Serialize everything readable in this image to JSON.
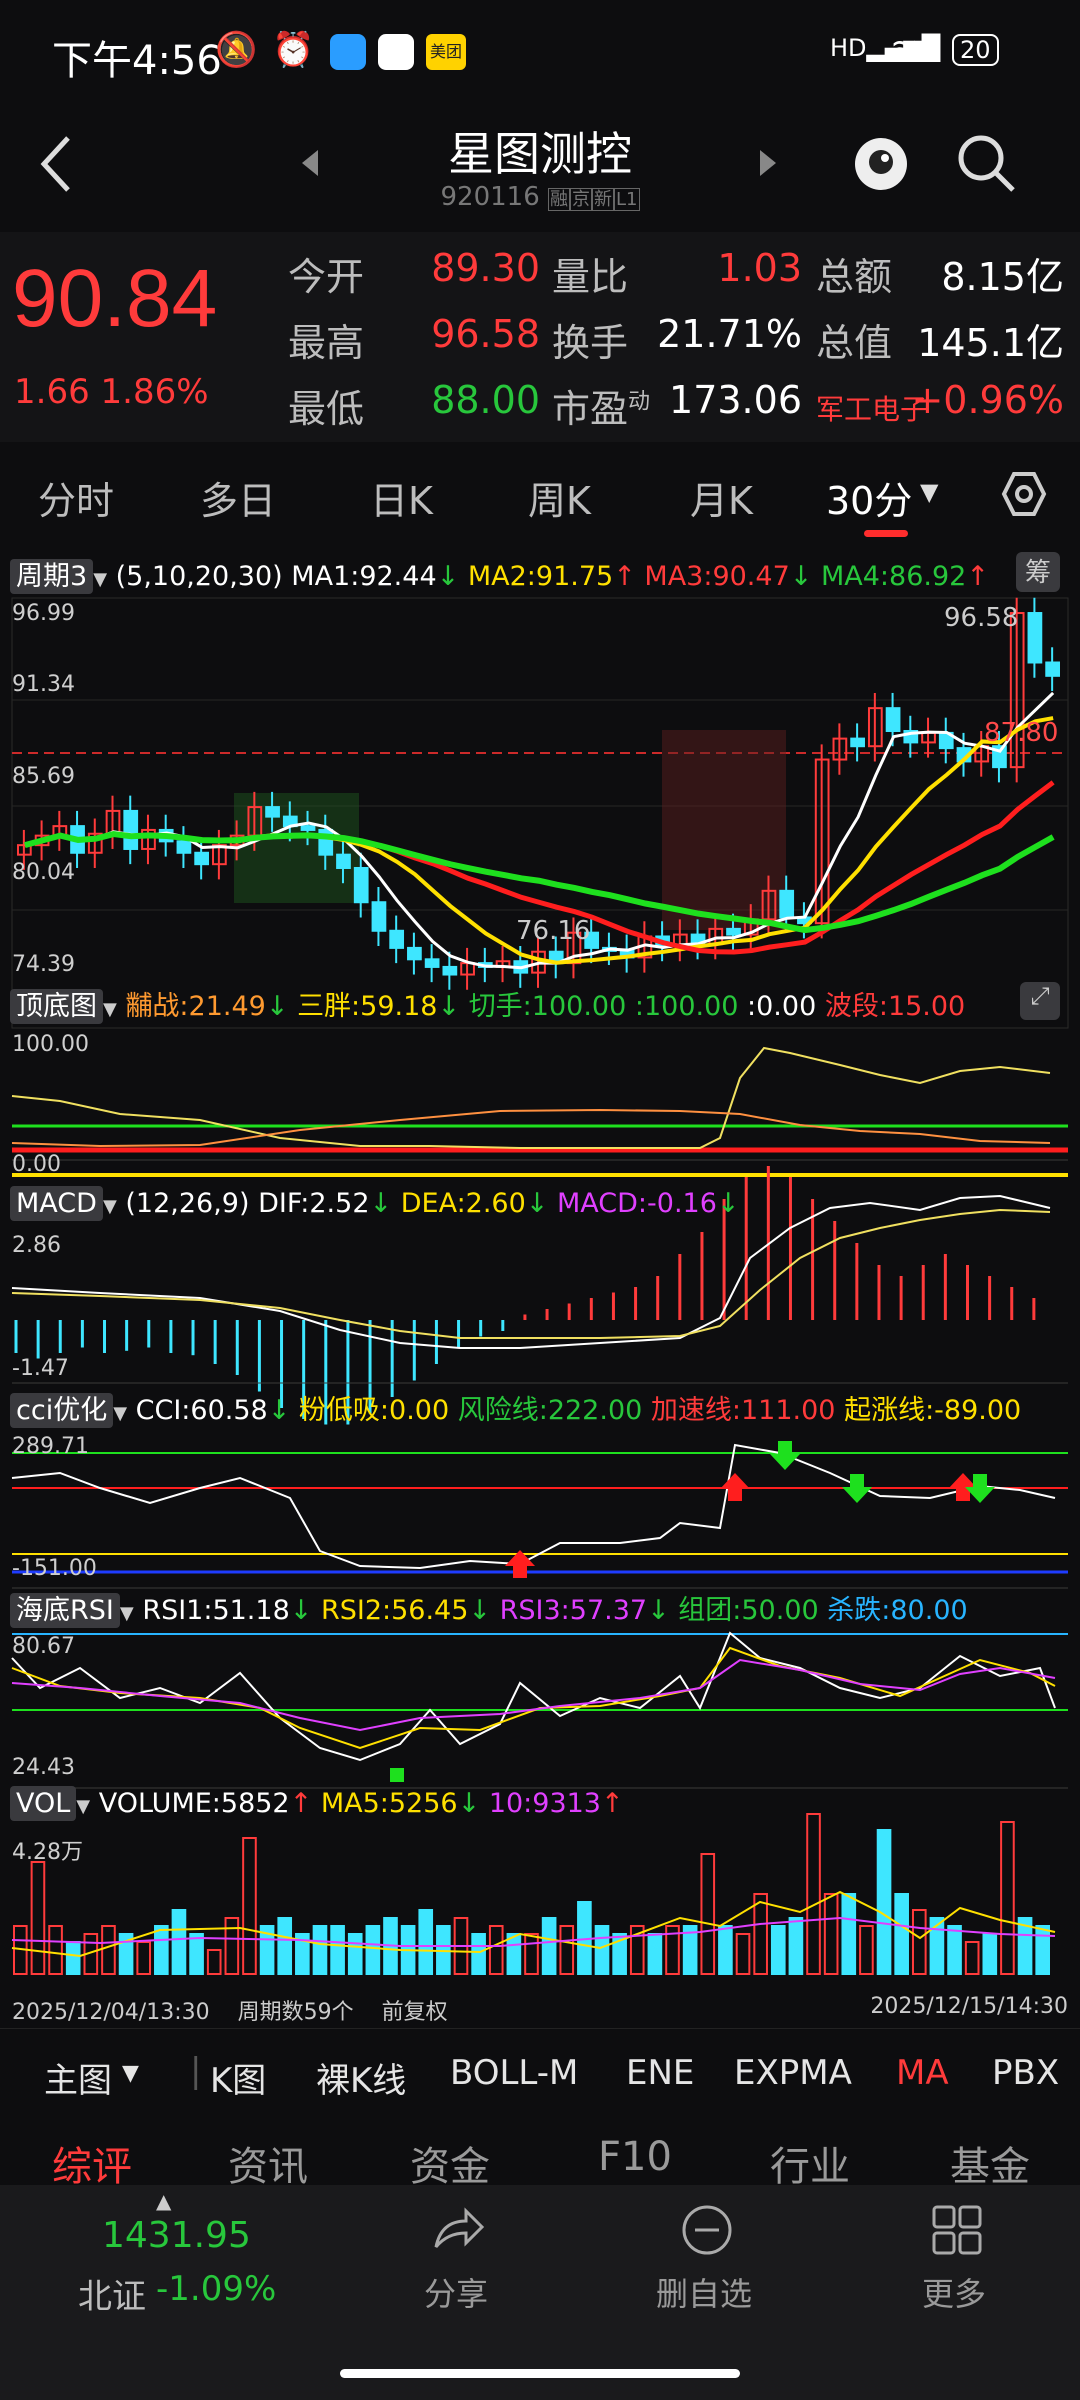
{
  "status": {
    "time": "下午4:56",
    "battery": "20",
    "app_badge": "美团"
  },
  "nav": {
    "title": "星图测控",
    "code": "920116",
    "tags": [
      "融",
      "京",
      "新",
      "L1"
    ]
  },
  "quote": {
    "price": "90.84",
    "change": "1.66",
    "change_pct": "1.86%",
    "rows": [
      [
        {
          "l": "今开",
          "v": "89.30",
          "c": "red"
        },
        {
          "l": "量比",
          "v": "1.03",
          "c": "red"
        },
        {
          "l": "总额",
          "v": "8.15亿",
          "c": "white"
        }
      ],
      [
        {
          "l": "最高",
          "v": "96.58",
          "c": "red"
        },
        {
          "l": "换手",
          "v": "21.71%",
          "c": "white"
        },
        {
          "l": "总值",
          "v": "145.1亿",
          "c": "white"
        }
      ],
      [
        {
          "l": "最低",
          "v": "88.00",
          "c": "green"
        },
        {
          "l": "市盈",
          "v": "173.06",
          "c": "white",
          "sup": "动"
        },
        {
          "l": "军工电子",
          "v": "+0.96%",
          "c": "red"
        }
      ]
    ]
  },
  "tabs": [
    "分时",
    "多日",
    "日K",
    "周K",
    "月K",
    "30分"
  ],
  "main_panel": {
    "btn": "周期3",
    "params": "(5,10,20,30)",
    "ma1": "MA1:92.44",
    "ma2": "MA2:91.75",
    "ma3": "MA3:90.47",
    "ma4": "MA4:86.92",
    "chip": "筹",
    "y_labels": [
      "96.99",
      "91.34",
      "85.69",
      "80.04",
      "74.39"
    ],
    "high_lbl": "96.58",
    "low_lbl": "76.16",
    "ref_lbl": "87.80"
  },
  "topbottom": {
    "btn": "顶底图",
    "v1": "黼战:21.49",
    "v2": "三胖:59.18",
    "v3": "切手:100.00",
    "v4": ":100.00",
    "v5": ":0.00",
    "v6": "波段:15.00",
    "y_top": "100.00",
    "y_bot": "0.00"
  },
  "macd": {
    "btn": "MACD",
    "params": "(12,26,9)",
    "dif": "DIF:2.52",
    "dea": "DEA:2.60",
    "macd": "MACD:-0.16",
    "y_top": "2.86",
    "y_bot": "-1.47"
  },
  "cci": {
    "btn": "cci优化",
    "cci": "CCI:60.58",
    "v1": "粉低吸:0.00",
    "v2": "风险线:222.00",
    "v3": "加速线:111.00",
    "v4": "起涨线:-89.00",
    "y_top": "289.71",
    "y_bot": "-151.00"
  },
  "rsi": {
    "btn": "海底RSI",
    "r1": "RSI1:51.18",
    "r2": "RSI2:56.45",
    "r3": "RSI3:57.37",
    "r4": "组团:50.00",
    "r5": "杀跌:80.00",
    "y_top": "80.67",
    "y_bot": "24.43"
  },
  "vol": {
    "btn": "VOL",
    "v": "VOLUME:5852",
    "ma5": "MA5:5256",
    "ma10": "10:9313",
    "y_top": "4.28万"
  },
  "footer_meta": {
    "start": "2025/12/04/13:30",
    "count": "周期数59个",
    "adj": "前复权",
    "end": "2025/12/15/14:30"
  },
  "tools": [
    "主图",
    "K图",
    "裸K线",
    "BOLL-M",
    "ENE",
    "EXPMA",
    "MA",
    "PBX"
  ],
  "sub_tabs": [
    "综评",
    "资讯",
    "资金",
    "F10",
    "行业",
    "基金"
  ],
  "bottom": {
    "index_val": "1431.95",
    "index_name": "北证",
    "index_chg": "-1.09%",
    "share": "分享",
    "del": "删自选",
    "more": "更多"
  }
}
